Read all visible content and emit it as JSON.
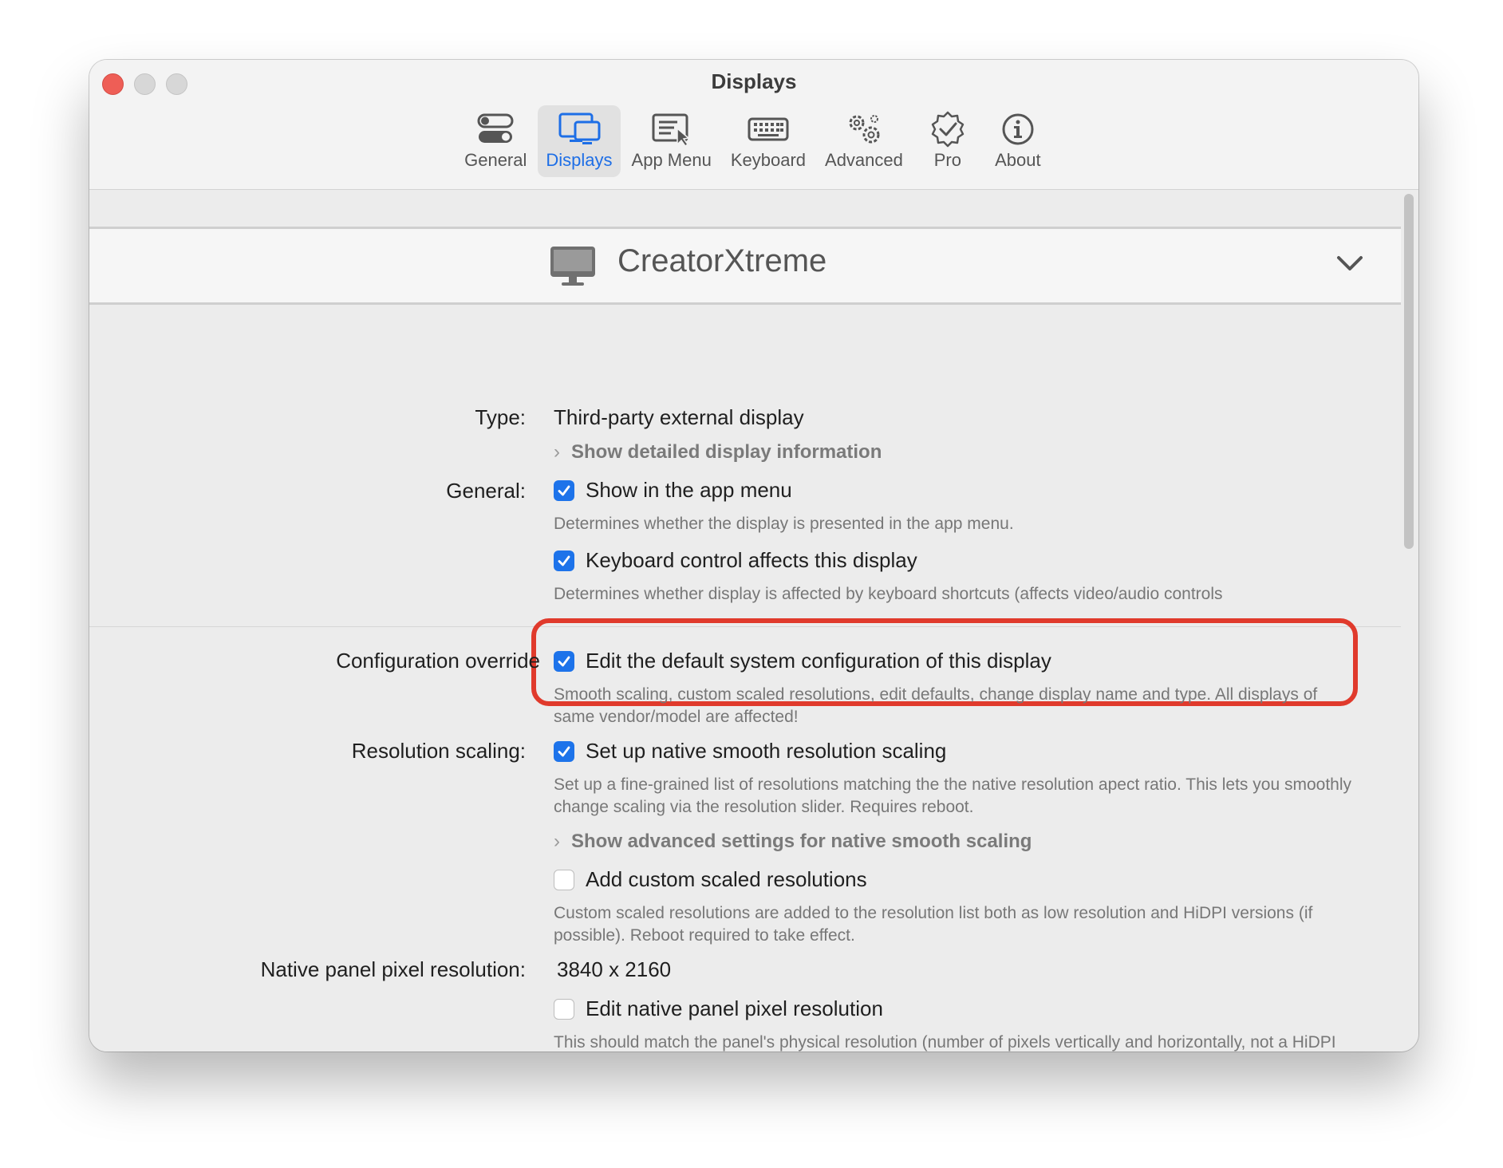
{
  "window": {
    "title": "Displays"
  },
  "toolbar": {
    "items": [
      {
        "label": "General",
        "icon": "toggles-icon",
        "active": false
      },
      {
        "label": "Displays",
        "icon": "displays-icon",
        "active": true
      },
      {
        "label": "App Menu",
        "icon": "app-menu-icon",
        "active": false
      },
      {
        "label": "Keyboard",
        "icon": "keyboard-icon",
        "active": false
      },
      {
        "label": "Advanced",
        "icon": "gears-icon",
        "active": false
      },
      {
        "label": "Pro",
        "icon": "verified-badge-icon",
        "active": false
      },
      {
        "label": "About",
        "icon": "info-icon",
        "active": false
      }
    ]
  },
  "display": {
    "name": "CreatorXtreme"
  },
  "type_row": {
    "label": "Type:",
    "value": "Third-party external display",
    "disclosure": "Show detailed display information"
  },
  "general_row": {
    "label": "General:",
    "show_in_menu": {
      "label": "Show in the app menu",
      "checked": true,
      "desc": "Determines whether the display is presented in the app menu."
    },
    "keyboard_control": {
      "label": "Keyboard control affects this display",
      "checked": true,
      "desc": "Determines whether display is affected by keyboard shortcuts (affects video/audio controls"
    }
  },
  "config_row": {
    "label": "Configuration override",
    "edit_default": {
      "label": "Edit the default system configuration of this display",
      "checked": true,
      "desc": "Smooth scaling, custom scaled resolutions, edit defaults, change display name and type. All displays of same vendor/model are affected!"
    }
  },
  "resolution_row": {
    "label": "Resolution scaling:",
    "native_smooth": {
      "label": "Set up native smooth resolution scaling",
      "checked": true,
      "desc": "Set up a fine-grained list of resolutions matching the the native resolution apect ratio. This lets you smoothly change scaling via the resolution slider. Requires reboot."
    },
    "disclosure": "Show advanced settings for native smooth scaling",
    "custom_scaled": {
      "label": "Add custom scaled resolutions",
      "checked": false,
      "desc": "Custom scaled resolutions are added to the resolution list both as low resolution and HiDPI versions (if possible). Reboot required to take effect."
    }
  },
  "native_row": {
    "label": "Native panel pixel resolution:",
    "value": "3840 x 2160",
    "edit_native": {
      "label": "Edit native panel pixel resolution",
      "checked": false,
      "desc": "This should match the panel's physical resolution (number of pixels vertically and horizontally, not a HiDPI resolution) and must correspond to an accepted resolution by the display. Change only if erroneously detected. Requires reboot to take effect."
    }
  },
  "colors": {
    "accent": "#1d73ea",
    "highlight": "#e03a2c",
    "close": "#ee5e56"
  }
}
